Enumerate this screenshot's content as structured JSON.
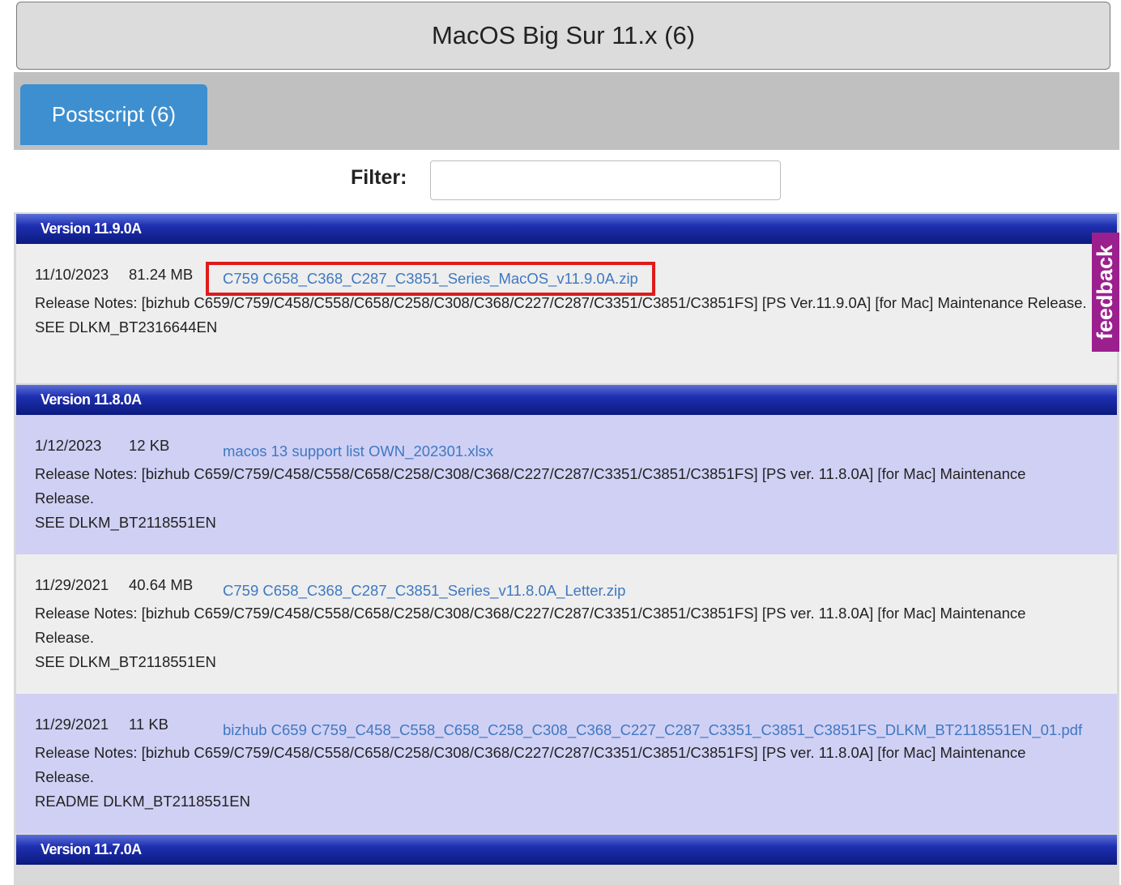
{
  "os_header": {
    "title": "MacOS Big Sur 11.x (6)"
  },
  "tabs": [
    {
      "label": "Postscript (6)"
    }
  ],
  "filter": {
    "label": "Filter:",
    "value": "",
    "placeholder": ""
  },
  "feedback": {
    "label": "feedback"
  },
  "versions": [
    {
      "title": "Version 11.9.0A",
      "entries": [
        {
          "date": "11/10/2023",
          "size": "81.24 MB",
          "file": "C759 C658_C368_C287_C3851_Series_MacOS_v11.9.0A.zip",
          "notes": "Release Notes: [bizhub C659/C759/C458/C558/C658/C258/C308/C368/C227/C287/C3351/C3851/C3851FS] [PS Ver.11.9.0A] [for Mac] Maintenance Release.",
          "ref": "SEE DLKM_BT2316644EN"
        }
      ]
    },
    {
      "title": "Version 11.8.0A",
      "entries": [
        {
          "date": "1/12/2023",
          "size": "12 KB",
          "file": "macos 13 support list OWN_202301.xlsx",
          "notes": "Release Notes: [bizhub C659/C759/C458/C558/C658/C258/C308/C368/C227/C287/C3351/C3851/C3851FS] [PS ver. 11.8.0A] [for Mac] Maintenance Release.",
          "ref": "SEE DLKM_BT2118551EN"
        },
        {
          "date": "11/29/2021",
          "size": "40.64 MB",
          "file": "C759 C658_C368_C287_C3851_Series_v11.8.0A_Letter.zip",
          "notes": "Release Notes: [bizhub C659/C759/C458/C558/C658/C258/C308/C368/C227/C287/C3351/C3851/C3851FS] [PS ver. 11.8.0A] [for Mac] Maintenance Release.",
          "ref": "SEE DLKM_BT2118551EN"
        },
        {
          "date": "11/29/2021",
          "size": "11 KB",
          "file": "bizhub C659 C759_C458_C558_C658_C258_C308_C368_C227_C287_C3351_C3851_C3851FS_DLKM_BT2118551EN_01.pdf",
          "notes": "Release Notes: [bizhub C659/C759/C458/C558/C658/C258/C308/C368/C227/C287/C3351/C3851/C3851FS] [PS ver. 11.8.0A] [for Mac] Maintenance Release.",
          "ref": "README DLKM_BT2118551EN"
        }
      ]
    },
    {
      "title": "Version 11.7.0A",
      "entries": []
    }
  ]
}
